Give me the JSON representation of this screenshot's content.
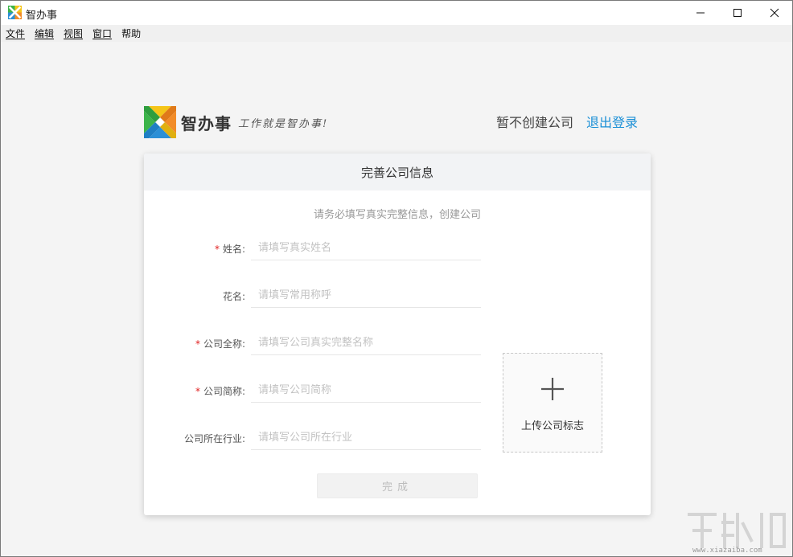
{
  "window": {
    "title": "智办事",
    "controls": [
      "minimize",
      "maximize",
      "close"
    ]
  },
  "menubar": {
    "items": [
      {
        "label": "文件"
      },
      {
        "label": "编辑"
      },
      {
        "label": "视图"
      },
      {
        "label": "窗口"
      },
      {
        "label": "帮助"
      }
    ]
  },
  "brand": {
    "name": "智办事",
    "slogan": "工作就是智办事!"
  },
  "header_links": {
    "skip": "暂不创建公司",
    "logout": "退出登录"
  },
  "form": {
    "title": "完善公司信息",
    "hint": "请务必填写真实完整信息，创建公司",
    "fields": [
      {
        "label": "姓名:",
        "required": true,
        "value": "",
        "placeholder": "请填写真实姓名"
      },
      {
        "label": "花名:",
        "required": false,
        "value": "",
        "placeholder": "请填写常用称呼"
      },
      {
        "label": "公司全称:",
        "required": true,
        "value": "",
        "placeholder": "请填写公司真实完整名称"
      },
      {
        "label": "公司简称:",
        "required": true,
        "value": "",
        "placeholder": "请填写公司简称"
      },
      {
        "label": "公司所在行业:",
        "required": false,
        "value": "",
        "placeholder": "请填写公司所在行业"
      }
    ],
    "required_mark": "*",
    "submit_label": "完成",
    "upload_label": "上传公司标志"
  },
  "watermark": {
    "text": "www.xiazaiba.com"
  },
  "colors": {
    "link_blue": "#1a8fd6",
    "required_red": "#e02020",
    "logo_green": "#3cb44a",
    "logo_orange": "#f28c28",
    "logo_blue": "#2b8fd6",
    "logo_yellow": "#f5c518"
  }
}
